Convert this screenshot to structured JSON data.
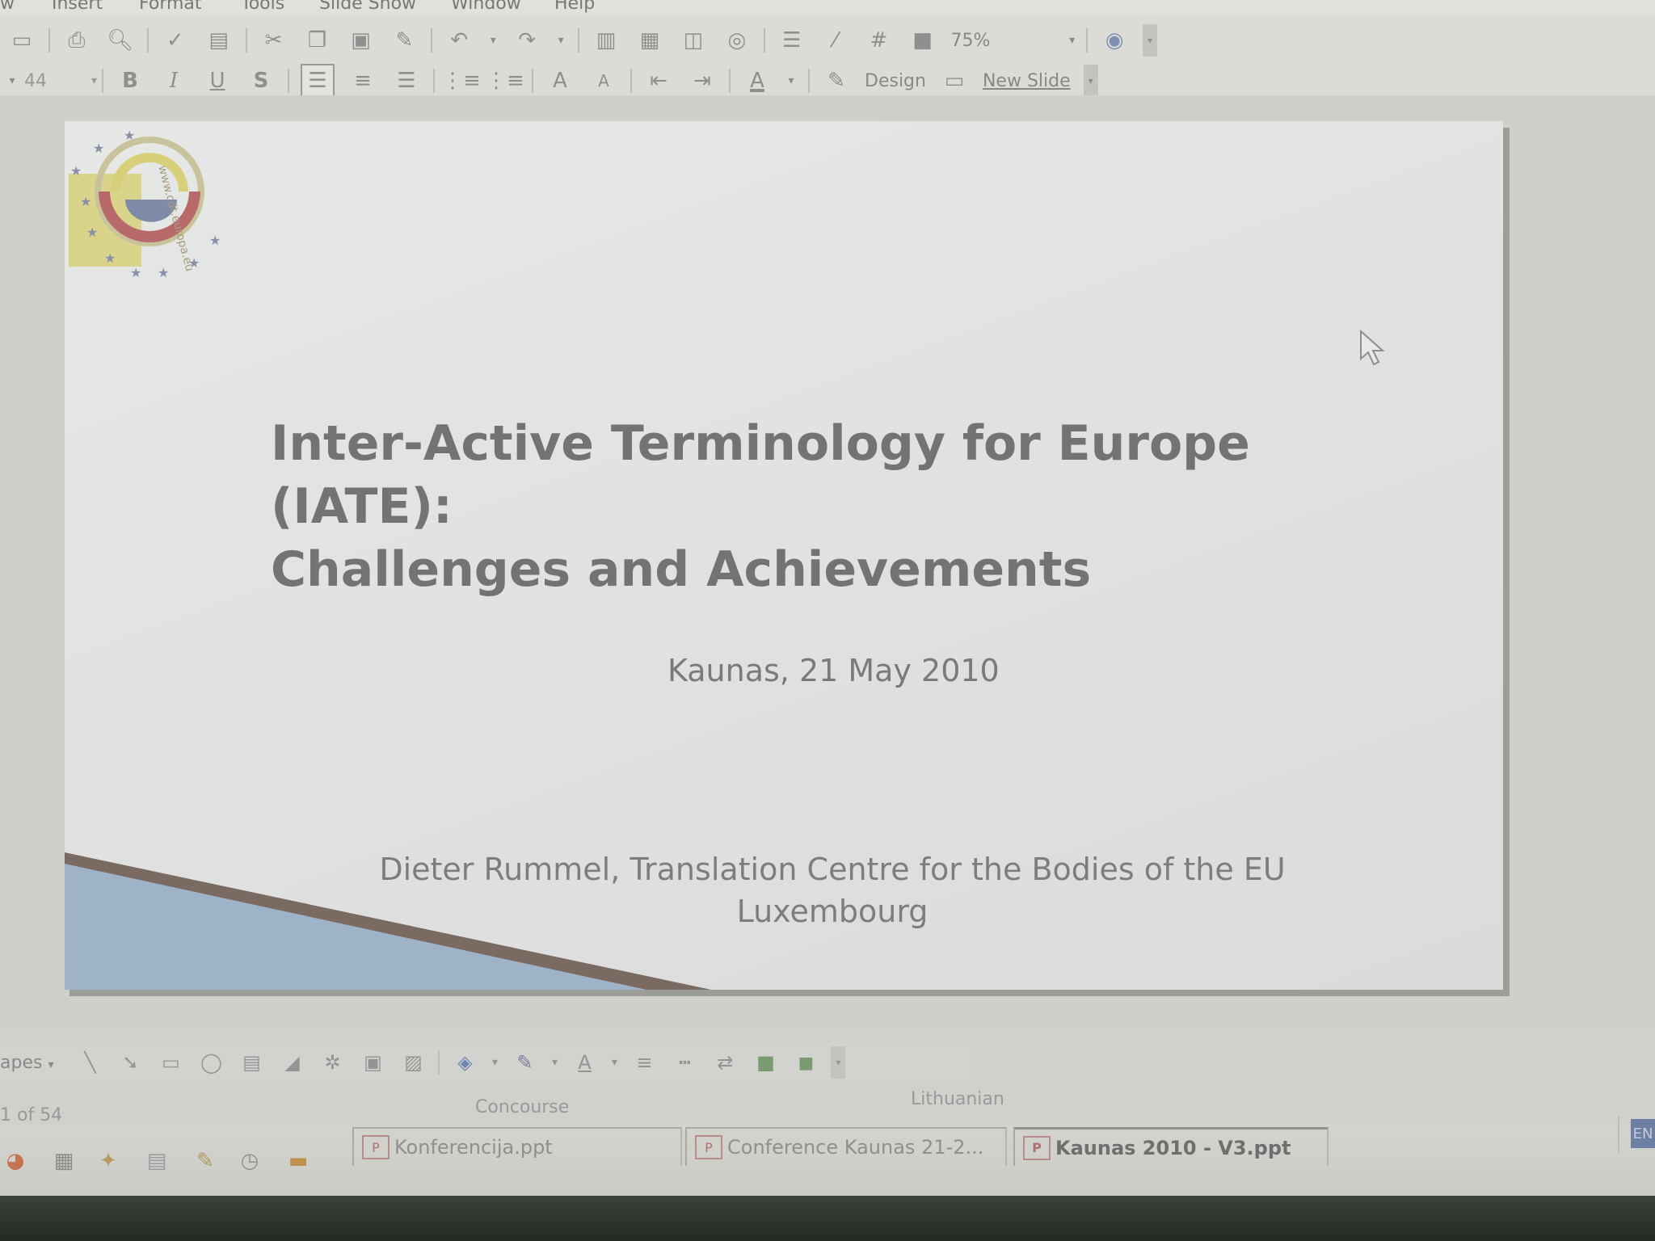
{
  "menubar": {
    "items": [
      "w",
      "Insert",
      "Format",
      "Tools",
      "Slide Show",
      "Window",
      "Help"
    ]
  },
  "toolbar": {
    "zoom": "75%",
    "font_size": "44",
    "bold": "B",
    "italic": "I",
    "underline": "U",
    "shadow": "S",
    "increase_font": "A",
    "decrease_font": "A",
    "font_color": "A",
    "design_label": "Design",
    "new_slide_label": "New Slide"
  },
  "slide": {
    "logo_text": "www.cdt.europa.eu",
    "title_line1": "Inter-Active Terminology for Europe (IATE):",
    "title_line2": "Challenges and Achievements",
    "date": "Kaunas, 21 May 2010",
    "author_line1": "Dieter Rummel, Translation Centre for the Bodies of the EU",
    "author_line2": "Luxembourg"
  },
  "drawing_toolbar": {
    "shapes_label": "apes",
    "font_color": "A"
  },
  "status": {
    "slide_counter": "1 of 54",
    "design_name": "Concourse",
    "language": "Lithuanian"
  },
  "taskbar": {
    "tasks": [
      {
        "label": "Konferencija.ppt"
      },
      {
        "label": "Conference Kaunas 21-2..."
      },
      {
        "label": "Kaunas 2010 - V3.ppt"
      }
    ],
    "language_indicator": "EN"
  },
  "colors": {
    "slide_bg": "#e0e2e1",
    "title_text": "#737373",
    "logo_yellow": "#d8cf7a",
    "logo_red": "#b86a6a",
    "logo_blue": "#7d8aa8",
    "wedge_blue": "#9fb3c8",
    "wedge_brown": "#7a6a62"
  }
}
